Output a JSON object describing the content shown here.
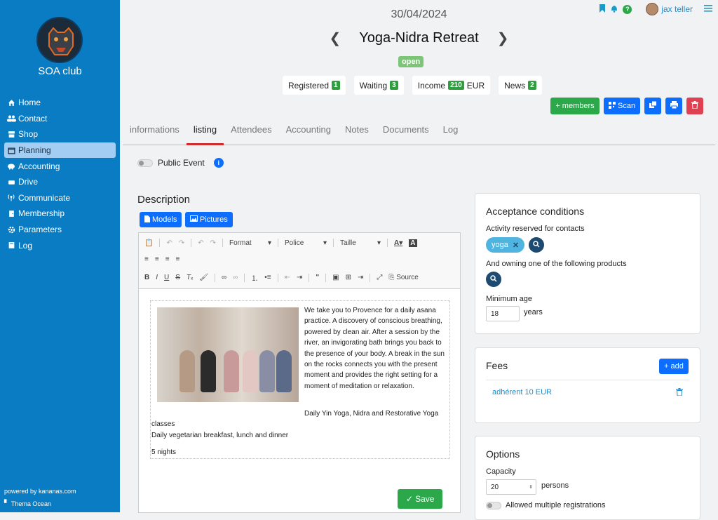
{
  "sidebar": {
    "club_name": "SOA club",
    "items": [
      {
        "label": "Home",
        "icon": "home-icon"
      },
      {
        "label": "Contact",
        "icon": "users-icon"
      },
      {
        "label": "Shop",
        "icon": "shop-icon"
      },
      {
        "label": "Planning",
        "icon": "calendar-icon"
      },
      {
        "label": "Accounting",
        "icon": "piggy-bank-icon"
      },
      {
        "label": "Drive",
        "icon": "drive-icon"
      },
      {
        "label": "Communicate",
        "icon": "broadcast-icon"
      },
      {
        "label": "Membership",
        "icon": "door-icon"
      },
      {
        "label": "Parameters",
        "icon": "gear-icon"
      },
      {
        "label": "Log",
        "icon": "book-icon"
      }
    ],
    "active": "Planning",
    "powered": "powered by kananas.com",
    "theme": "Thema Ocean"
  },
  "header": {
    "date": "30/04/2024",
    "user": "jax teller",
    "title": "Yoga-Nidra Retreat",
    "status": "open"
  },
  "stats": [
    {
      "label": "Registered",
      "badge": "1",
      "suffix": ""
    },
    {
      "label": "Waiting",
      "badge": "3",
      "suffix": ""
    },
    {
      "label": "Income",
      "badge": "210",
      "suffix": "EUR"
    },
    {
      "label": "News",
      "badge": "2",
      "suffix": ""
    }
  ],
  "actions": {
    "members": "+ members",
    "scan": "Scan"
  },
  "tabs": [
    "informations",
    "listing",
    "Attendees",
    "Accounting",
    "Notes",
    "Documents",
    "Log"
  ],
  "active_tab": "listing",
  "public_event": {
    "label": "Public Event",
    "enabled": false
  },
  "description": {
    "label": "Description",
    "models": "Models",
    "pictures": "Pictures",
    "toolbar": {
      "format": "Format",
      "police": "Police",
      "taille": "Taille",
      "source": "Source"
    },
    "paragraph": "We take you to Provence for a daily asana practice. A discovery of conscious breathing, powered by clean air. After a session by the river, an invigorating bath brings you back to the presence of your body. A break in the sun on the rocks connects you with the present moment and provides the right setting for a moment of meditation or relaxation.",
    "classes": "Daily Yin Yoga, Nidra and Restorative Yoga classes",
    "meals": "Daily vegetarian breakfast, lunch and dinner",
    "nights": "5 nights",
    "save": "Save"
  },
  "acceptance": {
    "title": "Acceptance conditions",
    "reserved": "Activity reserved for contacts",
    "chip": "yoga",
    "products": "And owning one of the following products",
    "min_age_label": "Minimum age",
    "min_age": "18",
    "years": "years"
  },
  "fees": {
    "title": "Fees",
    "add": "+ add",
    "item": "adhérent 10 EUR"
  },
  "options": {
    "title": "Options",
    "capacity_label": "Capacity",
    "capacity": "20",
    "persons": "persons",
    "multiple": "Allowed multiple registrations"
  }
}
